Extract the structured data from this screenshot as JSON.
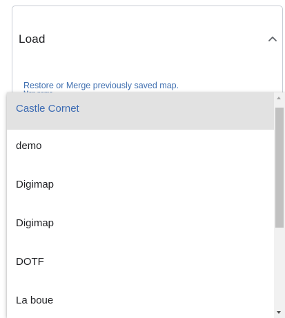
{
  "panel": {
    "title": "Load",
    "description": "Restore or Merge previously saved map.",
    "field_label": "Map name",
    "expand_icon": "chevron-up-icon"
  },
  "dropdown": {
    "selected": "Castle Cornet",
    "options": [
      {
        "label": "Castle Cornet"
      },
      {
        "label": "demo"
      },
      {
        "label": "Digimap"
      },
      {
        "label": "Digimap"
      },
      {
        "label": "DOTF"
      },
      {
        "label": "La boue"
      }
    ]
  },
  "colors": {
    "accent": "#3c6bb3",
    "selected_bg": "#e2e2e2",
    "text": "#202124",
    "border": "#c7ccd4"
  }
}
